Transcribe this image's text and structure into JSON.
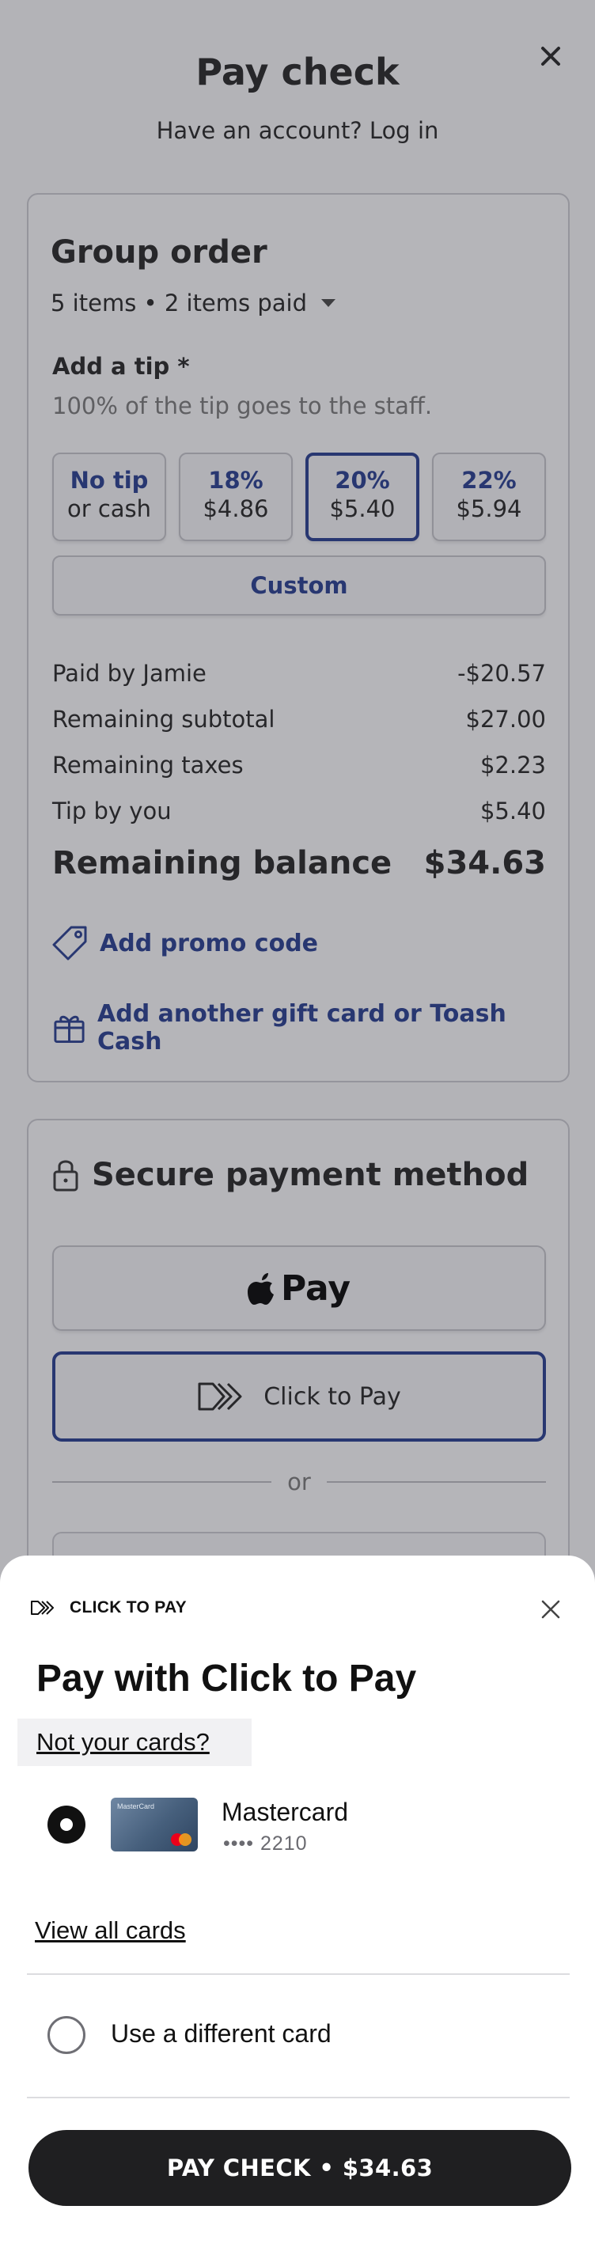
{
  "header": {
    "title": "Pay check",
    "login_prompt": "Have an account? Log in"
  },
  "group_order": {
    "title": "Group order",
    "items_summary": "5 items • 2 items paid",
    "tip_title": "Add a tip *",
    "tip_subtitle": "100% of the tip goes to the staff.",
    "tip_options": [
      {
        "label": "No tip",
        "value": "or cash"
      },
      {
        "label": "18%",
        "value": "$4.86"
      },
      {
        "label": "20%",
        "value": "$5.40"
      },
      {
        "label": "22%",
        "value": "$5.94"
      }
    ],
    "selected_tip": "20%",
    "custom_label": "Custom",
    "summary": [
      {
        "label": "Paid by Jamie",
        "value": "-$20.57"
      },
      {
        "label": "Remaining subtotal",
        "value": "$27.00"
      },
      {
        "label": "Remaining taxes",
        "value": "$2.23"
      },
      {
        "label": "Tip by you",
        "value": "$5.40"
      }
    ],
    "balance_label": "Remaining balance",
    "balance_value": "$34.63",
    "promo_link": "Add promo code",
    "gift_link": "Add another gift card or Toash Cash"
  },
  "payment": {
    "title": "Secure payment method",
    "apple_pay_label": "Pay",
    "click_to_pay_label": "Click to Pay",
    "or_label": "or"
  },
  "sheet": {
    "brand": "CLICK TO PAY",
    "title": "Pay with Click to Pay",
    "not_your_cards": "Not your cards?",
    "card": {
      "name": "Mastercard",
      "number": "•••• 2210",
      "art_text": "MasterCard"
    },
    "view_all": "View all cards",
    "different_card": "Use a different card",
    "pay_button": "PAY CHECK • $34.63"
  },
  "colors": {
    "accent": "#233a8e",
    "overlay": "#a9a9ad",
    "pay_button": "#1f1f21"
  }
}
